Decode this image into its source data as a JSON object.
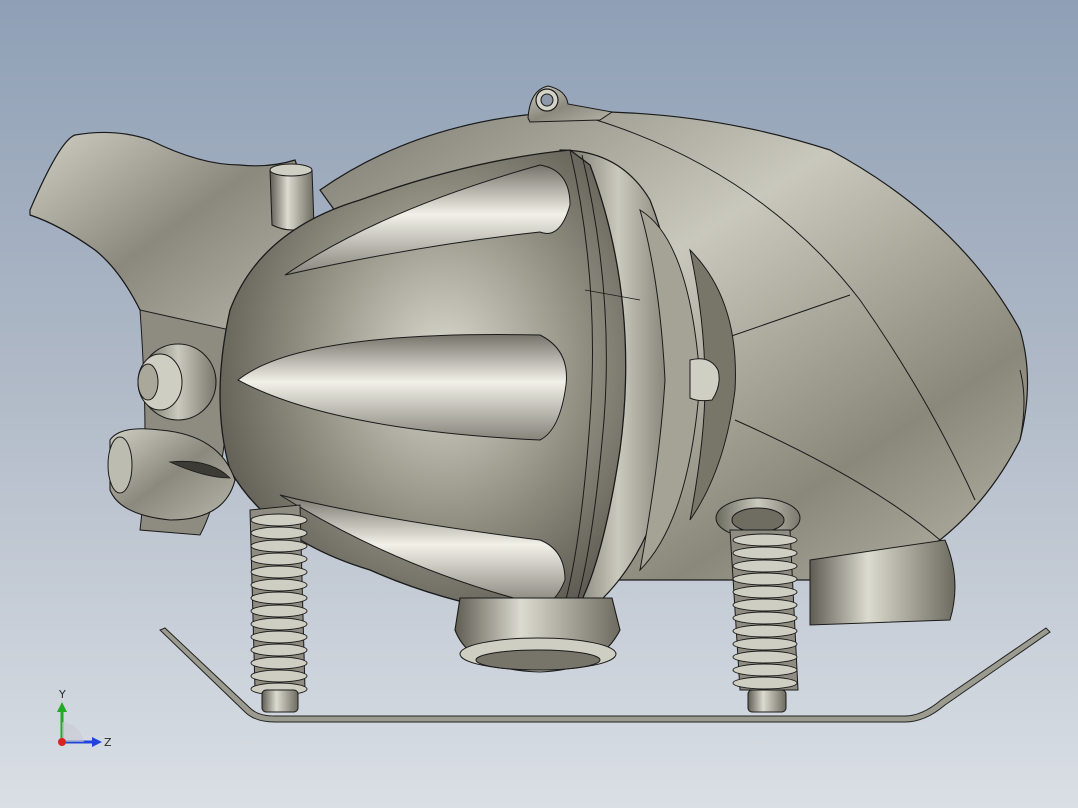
{
  "viewport": {
    "background_top": "#8fa0b6",
    "background_bottom": "#dadfe5"
  },
  "model": {
    "body_color": "#8c8a7c",
    "highlight_color": "#ecebe1",
    "edge_color": "#1a1a1a"
  },
  "triad": {
    "y_label": "Y",
    "z_label": "Z",
    "y_color": "#22aa22",
    "z_color": "#2244dd",
    "x_color": "#dd2222"
  }
}
